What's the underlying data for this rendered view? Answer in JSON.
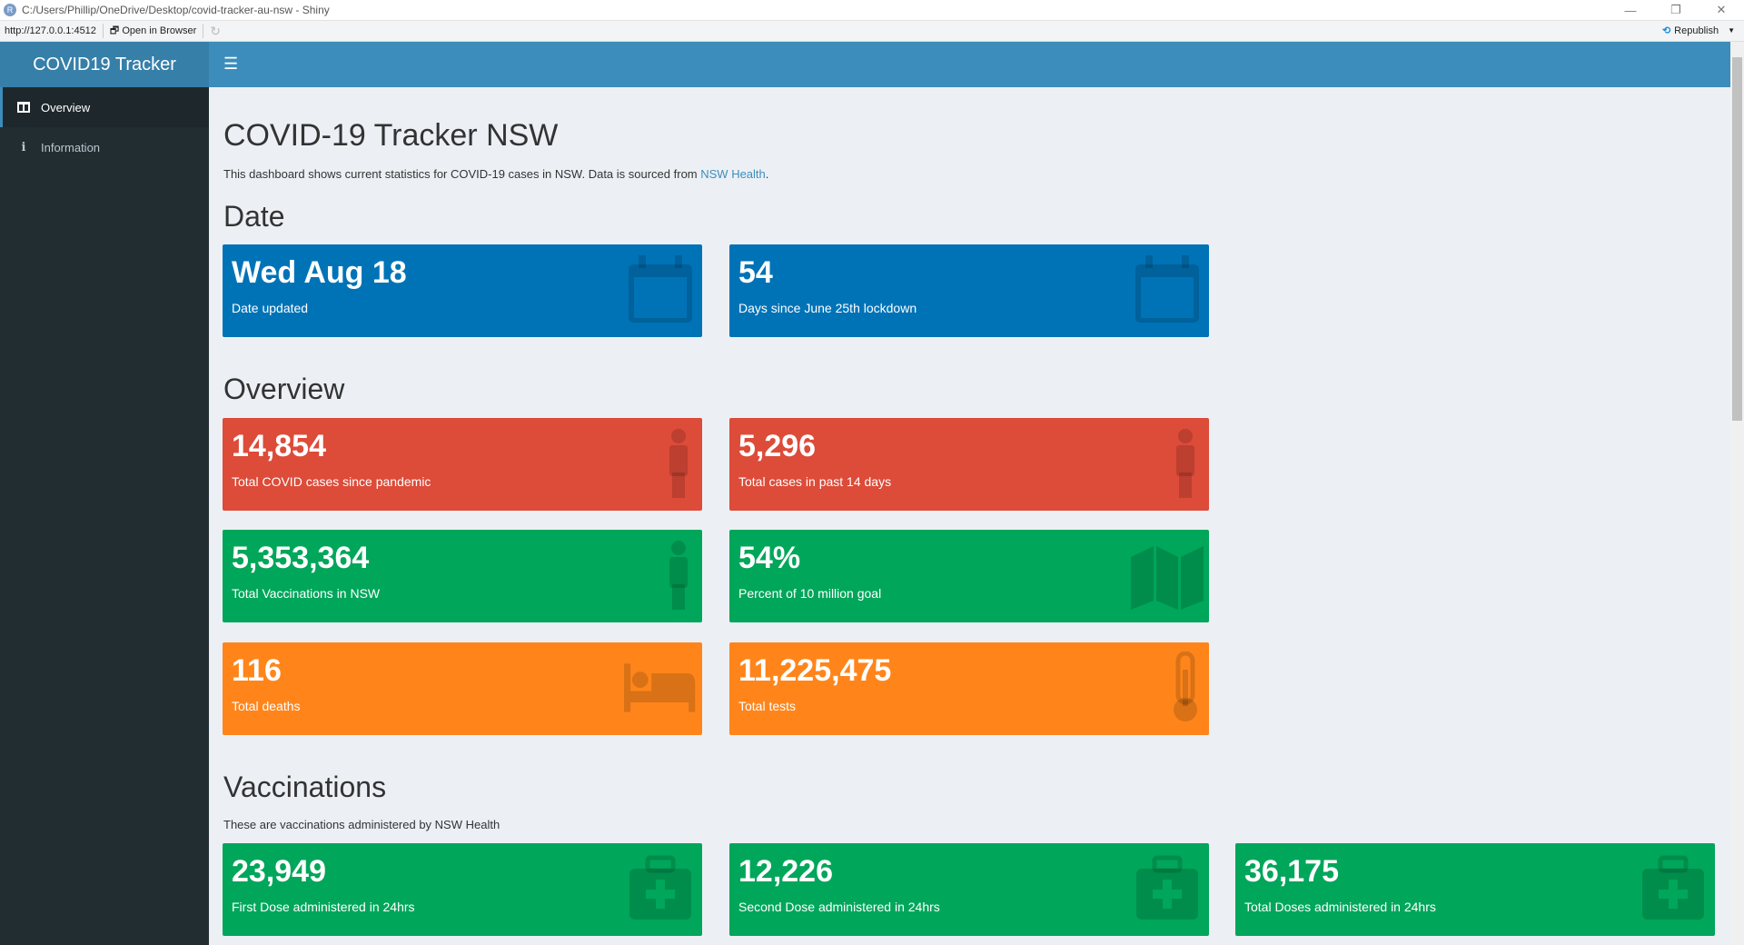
{
  "window": {
    "title": "C:/Users/Phillip/OneDrive/Desktop/covid-tracker-au-nsw - Shiny",
    "url": "http://127.0.0.1:4512",
    "open_browser": "Open in Browser",
    "republish": "Republish"
  },
  "header": {
    "logo": "COVID19 Tracker"
  },
  "sidebar": {
    "items": [
      {
        "label": "Overview",
        "icon": "dashboard-icon"
      },
      {
        "label": "Information",
        "icon": "info-icon"
      }
    ]
  },
  "main": {
    "title": "COVID-19 Tracker NSW",
    "description": "This dashboard shows current statistics for COVID-19 cases in NSW. Data is sourced from ",
    "source_link": "NSW Health",
    "source_end": ".",
    "date_heading": "Date",
    "date_boxes": [
      {
        "value": "Wed Aug 18",
        "label": "Date updated",
        "icon": "calendar-icon"
      },
      {
        "value": "54",
        "label": "Days since June 25th lockdown",
        "icon": "calendar-icon"
      }
    ],
    "overview_heading": "Overview",
    "overview_boxes": [
      {
        "value": "14,854",
        "label": "Total COVID cases since pandemic",
        "icon": "person-icon"
      },
      {
        "value": "5,296",
        "label": "Total cases in past 14 days",
        "icon": "person-icon"
      },
      {
        "value": "5,353,364",
        "label": "Total Vaccinations in NSW",
        "icon": "person-icon"
      },
      {
        "value": "54%",
        "label": "Percent of 10 million goal",
        "icon": "map-icon"
      },
      {
        "value": "116",
        "label": "Total deaths",
        "icon": "bed-icon"
      },
      {
        "value": "11,225,475",
        "label": "Total tests",
        "icon": "thermometer-icon"
      }
    ],
    "vacc_heading": "Vaccinations",
    "vacc_sub": "These are vaccinations administered by NSW Health",
    "vacc_boxes": [
      {
        "value": "23,949",
        "label": "First Dose administered in 24hrs"
      },
      {
        "value": "12,226",
        "label": "Second Dose administered in 24hrs"
      },
      {
        "value": "36,175",
        "label": "Total Doses administered in 24hrs"
      }
    ]
  },
  "colors": {
    "blue": "#0073b7",
    "red": "#dd4b39",
    "green": "#00a65a",
    "orange": "#ff851b",
    "header": "#3c8dbc",
    "sidebar": "#222d32"
  }
}
